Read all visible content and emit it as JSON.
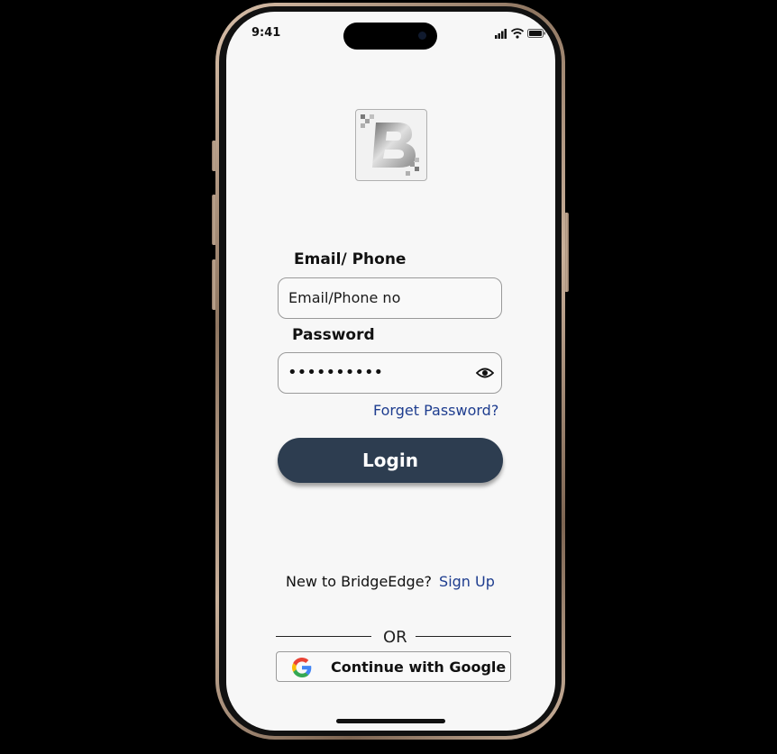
{
  "status_bar": {
    "time": "9:41"
  },
  "logo": {
    "letter": "B"
  },
  "form": {
    "email_label": "Email/ Phone",
    "email_placeholder": "Email/Phone no",
    "password_label": "Password",
    "password_value": "••••••••••",
    "forgot_link": "Forget Password?",
    "login_button": "Login"
  },
  "signup": {
    "prompt": "New to BridgeEdge?",
    "link": "Sign Up"
  },
  "divider": {
    "text": "OR"
  },
  "google": {
    "label": "Continue with Google"
  },
  "colors": {
    "accent": "#2d3d50",
    "link": "#1e3d8f",
    "background": "#f7f7f7"
  }
}
